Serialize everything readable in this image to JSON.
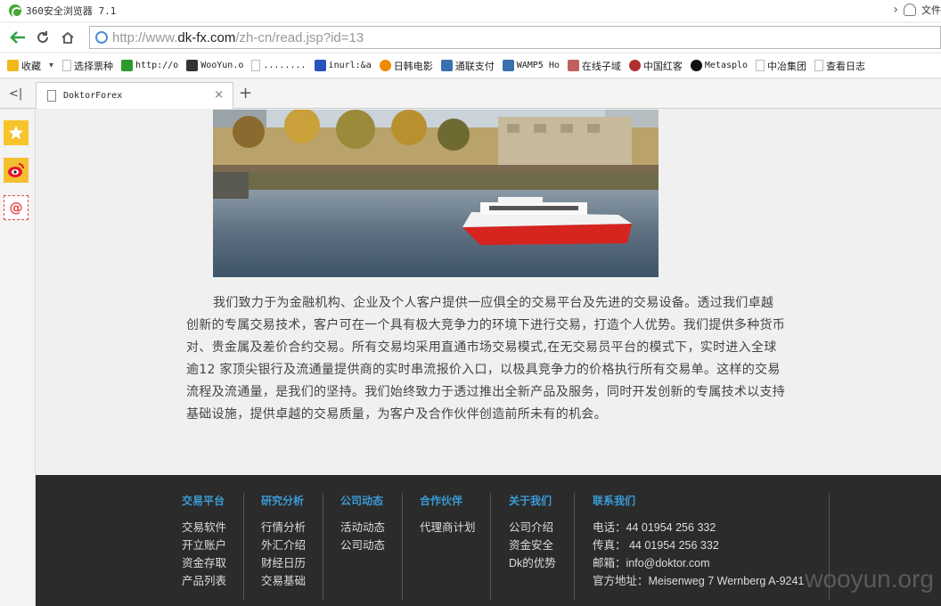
{
  "window": {
    "title": "360安全浏览器 7.1",
    "right_label": "文件"
  },
  "address": {
    "url_prefix": "http://www.",
    "url_host": "dk-fx.com",
    "url_path": "/zh-cn/read.jsp?id=13"
  },
  "bookmarks": [
    {
      "label": "收藏",
      "icon": "star-plus-icon"
    },
    {
      "label": "选择票种",
      "icon": "page-icon"
    },
    {
      "label": "http://o",
      "icon": "gear-green-icon"
    },
    {
      "label": "WooYun.o",
      "icon": "wooyun-icon"
    },
    {
      "label": "........",
      "icon": "page-icon"
    },
    {
      "label": "inurl:&a",
      "icon": "paw-icon"
    },
    {
      "label": "日韩电影",
      "icon": "play-icon"
    },
    {
      "label": "通联支付",
      "icon": "wamp-icon"
    },
    {
      "label": "WAMP5 Ho",
      "icon": "wamp-icon"
    },
    {
      "label": "在线子域",
      "icon": "cat-icon"
    },
    {
      "label": "中国红客",
      "icon": "badge-icon"
    },
    {
      "label": "Metasplo",
      "icon": "metasploit-icon"
    },
    {
      "label": "中冶集团",
      "icon": "page-icon"
    },
    {
      "label": "查看日志",
      "icon": "page-icon"
    }
  ],
  "tab": {
    "title": "DoktorForex"
  },
  "article": {
    "paragraph": "我们致力于为金融机构、企业及个人客户提供一应俱全的交易平台及先进的交易设备。透过我们卓越创新的专属交易技术，客户可在一个具有极大竞争力的环境下进行交易，打造个人优势。我们提供多种货币对、贵金属及差价合约交易。所有交易均采用直通市场交易模式,在无交易员平台的模式下，实时进入全球逾12 家顶尖银行及流通量提供商的实时串流报价入口，以极具竞争力的价格执行所有交易单。这样的交易流程及流通量，是我们的坚持。我们始终致力于透过推出全新产品及服务，同时开发创新的专属技术以支持基础设施，提供卓越的交易质量，为客户及合作伙伴创造前所未有的机会。",
    "photo": "london-tower-ferry-photo"
  },
  "footer": {
    "columns": [
      {
        "title": "交易平台",
        "items": [
          "交易软件",
          "开立账户",
          "资金存取",
          "产品列表"
        ]
      },
      {
        "title": "研究分析",
        "items": [
          "行情分析",
          "外汇介绍",
          "财经日历",
          "交易基础"
        ]
      },
      {
        "title": "公司动态",
        "items": [
          "活动动态",
          "公司动态"
        ]
      },
      {
        "title": "合作伙伴",
        "items": [
          "代理商计划"
        ]
      },
      {
        "title": "关于我们",
        "items": [
          "公司介绍",
          "资金安全",
          "Dk的优势"
        ]
      },
      {
        "title": "联系我们",
        "items": [
          "电话：44 01954 256 332",
          "传真： 44 01954 256 332",
          "邮箱：info@doktor.com",
          "官方地址：Meisenweg 7 Wernberg A-9241"
        ]
      }
    ],
    "watermark": "wooyun.org"
  },
  "colors": {
    "footer_bg": "#2b2b2b",
    "footer_heading": "#3a9bd5",
    "accent_green": "#43a832"
  }
}
